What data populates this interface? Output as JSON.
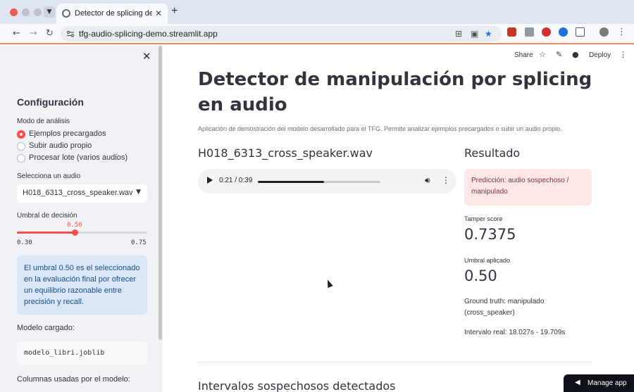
{
  "browser": {
    "tab_title": "Detector de splicing de audio",
    "tab_close": "✕",
    "new_tab": "+",
    "url": "tfg-audio-splicing-demo.streamlit.app",
    "colors": {
      "tabbar": "#dfe5ee",
      "toolbar": "#f7f9fc",
      "accent_line": "#f08a5d"
    }
  },
  "sidebar": {
    "close_icon": "✕",
    "title": "Configuración",
    "mode_label": "Modo de análisis",
    "mode_options": [
      {
        "label": "Ejemplos precargados",
        "checked": true
      },
      {
        "label": "Subir audio propio",
        "checked": false
      },
      {
        "label": "Procesar lote (varios audios)",
        "checked": false
      }
    ],
    "select_label": "Selecciona un audio",
    "select_value": "H018_6313_cross_speaker.wav",
    "threshold_label": "Umbral de decisión",
    "threshold": {
      "value": 0.5,
      "value_text": "0.50",
      "min": 0.3,
      "min_text": "0.30",
      "max": 0.75,
      "max_text": "0.75"
    },
    "info_text": "El umbral 0.50 es el seleccionado en la evaluación final por ofrecer un equilibrio razonable entre precisión y recall.",
    "model_label": "Modelo cargado:",
    "model_file": "modelo_libri.joblib",
    "columns_label": "Columnas usadas por el modelo:"
  },
  "header": {
    "share_label": "Share",
    "deploy_label": "Deploy"
  },
  "main": {
    "title": "Detector de manipulación por splicing en audio",
    "caption": "Aplicación de demostración del modelo desarrollado para el TFG. Permite analizar ejemplos precargados o subir un audio propio.",
    "file_name": "H018_6313_cross_speaker.wav",
    "audio": {
      "time": "0:21 / 0:39",
      "progress": 0.54
    },
    "result_title": "Resultado",
    "prediction": "Predicción: audio sospechoso / manipulado",
    "tamper_score_label": "Tamper score",
    "tamper_score_value": "0.7375",
    "threshold_label": "Umbral aplicado",
    "threshold_value": "0.50",
    "ground_truth": "Ground truth: manipulado (cross_speaker)",
    "interval": "Intervalo real: 18.027s - 19.709s",
    "section_title": "Intervalos sospechosos detectados"
  },
  "footer": {
    "manage_app_label": "Manage app"
  },
  "colors": {
    "primary": "#ff4b4b",
    "sidebar_bg": "#f0f2f6",
    "info_bg": "#d9e6f5",
    "error_bg": "#fde6e6",
    "text": "#31333f"
  }
}
